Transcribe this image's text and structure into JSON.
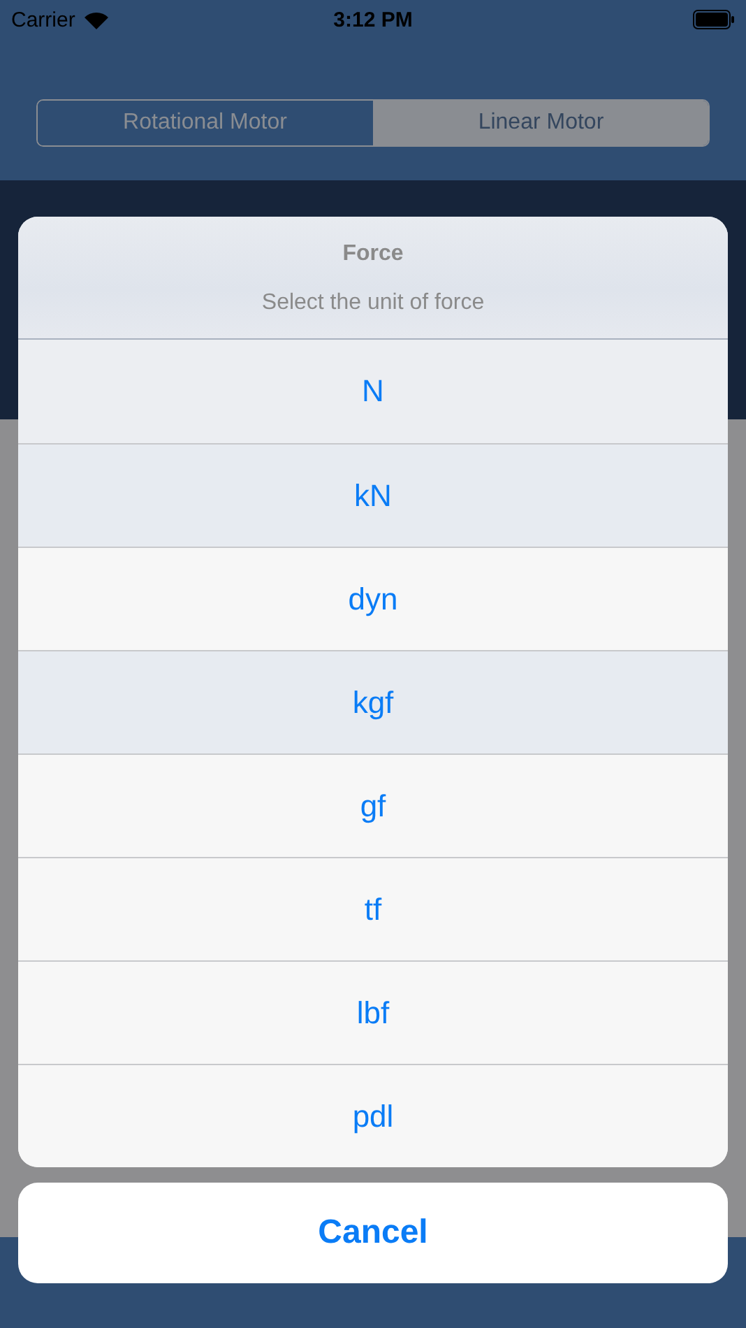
{
  "status_bar": {
    "carrier": "Carrier",
    "time": "3:12 PM"
  },
  "segments": [
    {
      "label": "Rotational Motor",
      "selected": false
    },
    {
      "label": "Linear Motor",
      "selected": true
    }
  ],
  "action_sheet": {
    "title": "Force",
    "message": "Select the unit of force",
    "options": [
      "N",
      "kN",
      "dyn",
      "kgf",
      "gf",
      "tf",
      "lbf",
      "pdl"
    ],
    "cancel": "Cancel"
  }
}
